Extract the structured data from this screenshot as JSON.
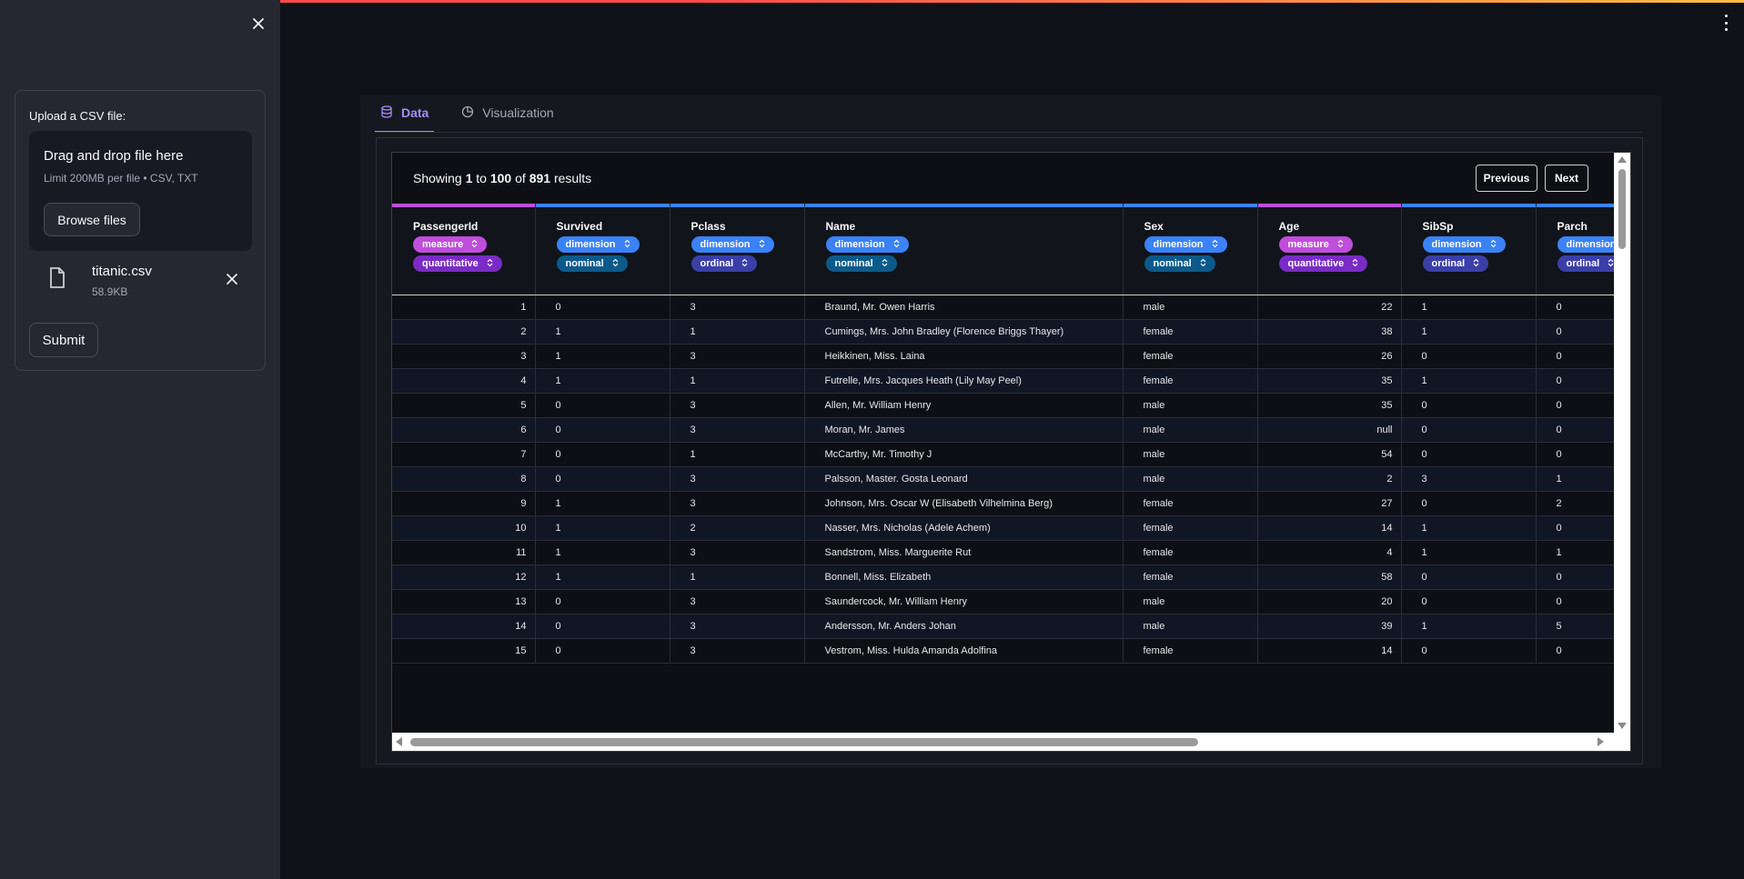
{
  "sidebar": {
    "upload_label": "Upload a CSV file:",
    "dropzone_title": "Drag and drop file here",
    "dropzone_limit": "Limit 200MB per file • CSV, TXT",
    "browse_label": "Browse files",
    "file_name": "titanic.csv",
    "file_size": "58.9KB",
    "submit_label": "Submit"
  },
  "tabs": [
    {
      "label": "Data",
      "active": true,
      "icon": "database-icon"
    },
    {
      "label": "Visualization",
      "active": false,
      "icon": "chart-pie-icon"
    }
  ],
  "grid": {
    "showing_prefix": "Showing",
    "from": "1",
    "to_word": "to",
    "to": "100",
    "of_word": "of",
    "total": "891",
    "results_word": "results",
    "prev_label": "Previous",
    "next_label": "Next",
    "columns": [
      {
        "name": "PassengerId",
        "pills": [
          "measure",
          "quantitative"
        ],
        "bar": "#c04ddb"
      },
      {
        "name": "Survived",
        "pills": [
          "dimension",
          "nominal"
        ],
        "bar": "#3b82f6"
      },
      {
        "name": "Pclass",
        "pills": [
          "dimension",
          "ordinal"
        ],
        "bar": "#3b82f6"
      },
      {
        "name": "Name",
        "pills": [
          "dimension",
          "nominal"
        ],
        "bar": "#3b82f6"
      },
      {
        "name": "Sex",
        "pills": [
          "dimension",
          "nominal"
        ],
        "bar": "#3b82f6"
      },
      {
        "name": "Age",
        "pills": [
          "measure",
          "quantitative"
        ],
        "bar": "#c04ddb"
      },
      {
        "name": "SibSp",
        "pills": [
          "dimension",
          "ordinal"
        ],
        "bar": "#3b82f6"
      },
      {
        "name": "Parch",
        "pills": [
          "dimension",
          "ordinal"
        ],
        "bar": "#3b82f6"
      }
    ],
    "rows": [
      [
        "1",
        "0",
        "3",
        "Braund, Mr. Owen Harris",
        "male",
        "22",
        "1",
        "0"
      ],
      [
        "2",
        "1",
        "1",
        "Cumings, Mrs. John Bradley (Florence Briggs Thayer)",
        "female",
        "38",
        "1",
        "0"
      ],
      [
        "3",
        "1",
        "3",
        "Heikkinen, Miss. Laina",
        "female",
        "26",
        "0",
        "0"
      ],
      [
        "4",
        "1",
        "1",
        "Futrelle, Mrs. Jacques Heath (Lily May Peel)",
        "female",
        "35",
        "1",
        "0"
      ],
      [
        "5",
        "0",
        "3",
        "Allen, Mr. William Henry",
        "male",
        "35",
        "0",
        "0"
      ],
      [
        "6",
        "0",
        "3",
        "Moran, Mr. James",
        "male",
        "null",
        "0",
        "0"
      ],
      [
        "7",
        "0",
        "1",
        "McCarthy, Mr. Timothy J",
        "male",
        "54",
        "0",
        "0"
      ],
      [
        "8",
        "0",
        "3",
        "Palsson, Master. Gosta Leonard",
        "male",
        "2",
        "3",
        "1"
      ],
      [
        "9",
        "1",
        "3",
        "Johnson, Mrs. Oscar W (Elisabeth Vilhelmina Berg)",
        "female",
        "27",
        "0",
        "2"
      ],
      [
        "10",
        "1",
        "2",
        "Nasser, Mrs. Nicholas (Adele Achem)",
        "female",
        "14",
        "1",
        "0"
      ],
      [
        "11",
        "1",
        "3",
        "Sandstrom, Miss. Marguerite Rut",
        "female",
        "4",
        "1",
        "1"
      ],
      [
        "12",
        "1",
        "1",
        "Bonnell, Miss. Elizabeth",
        "female",
        "58",
        "0",
        "0"
      ],
      [
        "13",
        "0",
        "3",
        "Saundercock, Mr. William Henry",
        "male",
        "20",
        "0",
        "0"
      ],
      [
        "14",
        "0",
        "3",
        "Andersson, Mr. Anders Johan",
        "male",
        "39",
        "1",
        "5"
      ],
      [
        "15",
        "0",
        "3",
        "Vestrom, Miss. Hulda Amanda Adolfina",
        "female",
        "14",
        "0",
        "0"
      ]
    ]
  }
}
